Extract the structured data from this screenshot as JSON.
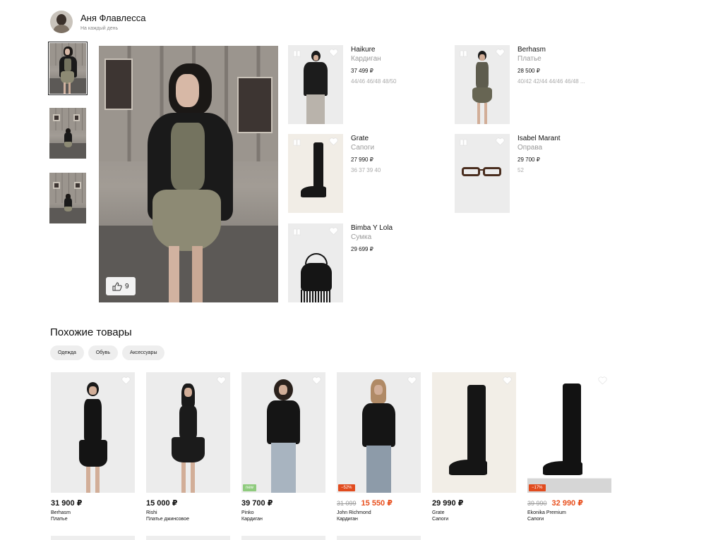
{
  "author": {
    "name": "Аня Флавлесса",
    "subtitle": "На каждый день"
  },
  "main_photo": {
    "likes": "9"
  },
  "look_items": [
    {
      "brand": "Haikure",
      "type": "Кардиган",
      "price": "37 499 ₽",
      "sizes": "44/46 46/48 48/50"
    },
    {
      "brand": "Berhasm",
      "type": "Платье",
      "price": "28 500 ₽",
      "sizes": "40/42 42/44 44/46 46/48 ..."
    },
    {
      "brand": "Grate",
      "type": "Сапоги",
      "price": "27 990 ₽",
      "sizes": "36 37 39 40"
    },
    {
      "brand": "Isabel Marant",
      "type": "Оправа",
      "price": "29 700 ₽",
      "sizes": "52"
    },
    {
      "brand": "Bimba Y Lola",
      "type": "Сумка",
      "price": "29 699 ₽",
      "sizes": ""
    }
  ],
  "similar": {
    "title": "Похожие товары",
    "chips": [
      "Одежда",
      "Обувь",
      "Аксессуары"
    ],
    "products": [
      {
        "price": "31 900 ₽",
        "old_price": "",
        "badge": "",
        "brand": "Berhasm",
        "type": "Платье"
      },
      {
        "price": "15 000 ₽",
        "old_price": "",
        "badge": "",
        "brand": "Rishi",
        "type": "Платье джинсовое"
      },
      {
        "price": "39 700 ₽",
        "old_price": "",
        "badge": "new",
        "brand": "Pinko",
        "type": "Кардиган"
      },
      {
        "price": "15 550 ₽",
        "old_price": "31 099",
        "badge": "−52%",
        "brand": "John Richmond",
        "type": "Кардиган"
      },
      {
        "price": "29 990 ₽",
        "old_price": "",
        "badge": "",
        "brand": "Grate",
        "type": "Сапоги"
      },
      {
        "price": "32 990 ₽",
        "old_price": "39 990",
        "badge": "−17%",
        "brand": "Ekonika Premium",
        "type": "Сапоги"
      }
    ]
  },
  "colors": {
    "accent_sale": "#e84f1d",
    "badge_new": "#8fcb7e",
    "placeholder": "#ececec"
  }
}
